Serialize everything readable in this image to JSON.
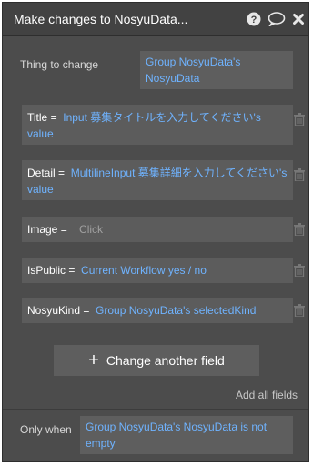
{
  "header": {
    "title": "Make changes to NosyuData...",
    "icons": [
      "help-icon",
      "comment-icon",
      "close-icon"
    ]
  },
  "thing_to_change": {
    "label": "Thing to change",
    "value": "Group NosyuData's NosyuData"
  },
  "fields": [
    {
      "name": "Title",
      "value": "Input 募集タイトルを入力してください's value"
    },
    {
      "name": "Detail",
      "value": "MultilineInput 募集詳細を入力してください's value"
    },
    {
      "name": "Image",
      "placeholder": "Click"
    },
    {
      "name": "IsPublic",
      "value": "Current Workflow yes / no"
    },
    {
      "name": "NosyuKind",
      "value": "Group NosyuData's selectedKind"
    }
  ],
  "buttons": {
    "change_another": "Change another field",
    "add_all": "Add all fields"
  },
  "only_when": {
    "label": "Only when",
    "value": "Group NosyuData's NosyuData is not empty"
  },
  "colors": {
    "panel_bg": "#4c4c4c",
    "header_bg": "#424242",
    "value_text": "#6fb3ff"
  }
}
